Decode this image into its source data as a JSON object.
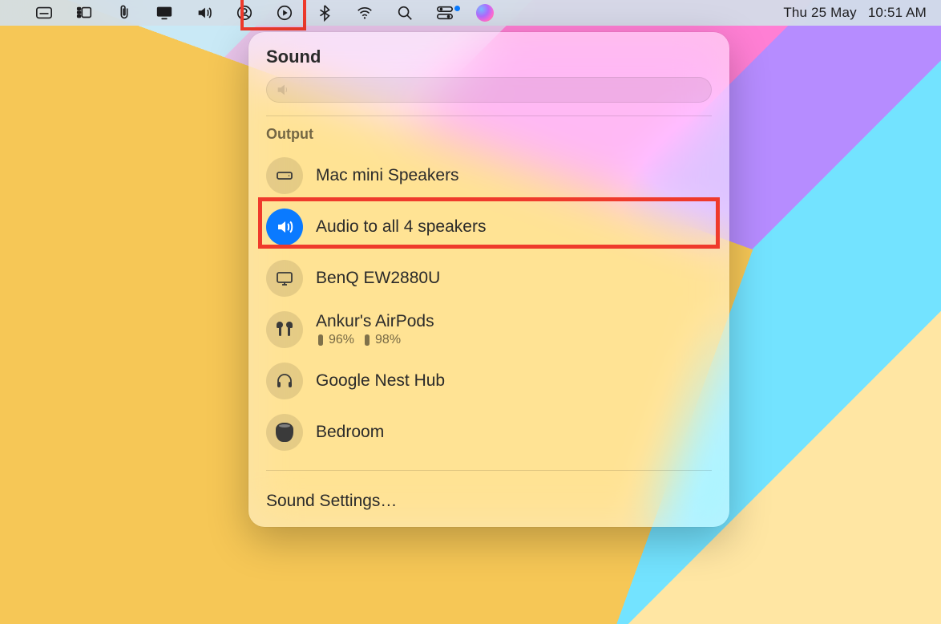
{
  "menubar": {
    "date": "Thu 25 May",
    "time": "10:51 AM",
    "icons": [
      "keyboard-viewer-icon",
      "stage-manager-icon",
      "attachment-icon",
      "display-icon",
      "sound-icon",
      "user-icon",
      "now-playing-icon",
      "bluetooth-icon",
      "wifi-icon",
      "spotlight-icon",
      "control-center-icon",
      "siri-icon"
    ],
    "active_icon": "sound-icon"
  },
  "popover": {
    "title": "Sound",
    "volume_percent": 0,
    "output_heading": "Output",
    "devices": [
      {
        "icon": "mac-mini-icon",
        "name": "Mac mini Speakers",
        "selected": false
      },
      {
        "icon": "speaker-icon",
        "name": "Audio to all 4 speakers",
        "selected": true
      },
      {
        "icon": "monitor-icon",
        "name": "BenQ EW2880U",
        "selected": false
      },
      {
        "icon": "airpods-icon",
        "name": "Ankur's AirPods",
        "selected": false,
        "battery": {
          "left": "96%",
          "right": "98%"
        }
      },
      {
        "icon": "headphones-icon",
        "name": "Google Nest Hub",
        "selected": false
      },
      {
        "icon": "homepod-icon",
        "name": "Bedroom",
        "selected": false
      }
    ],
    "settings_link": "Sound Settings…"
  },
  "annotations": {
    "menubar_sound_highlight": true,
    "selected_device_highlight": true
  }
}
